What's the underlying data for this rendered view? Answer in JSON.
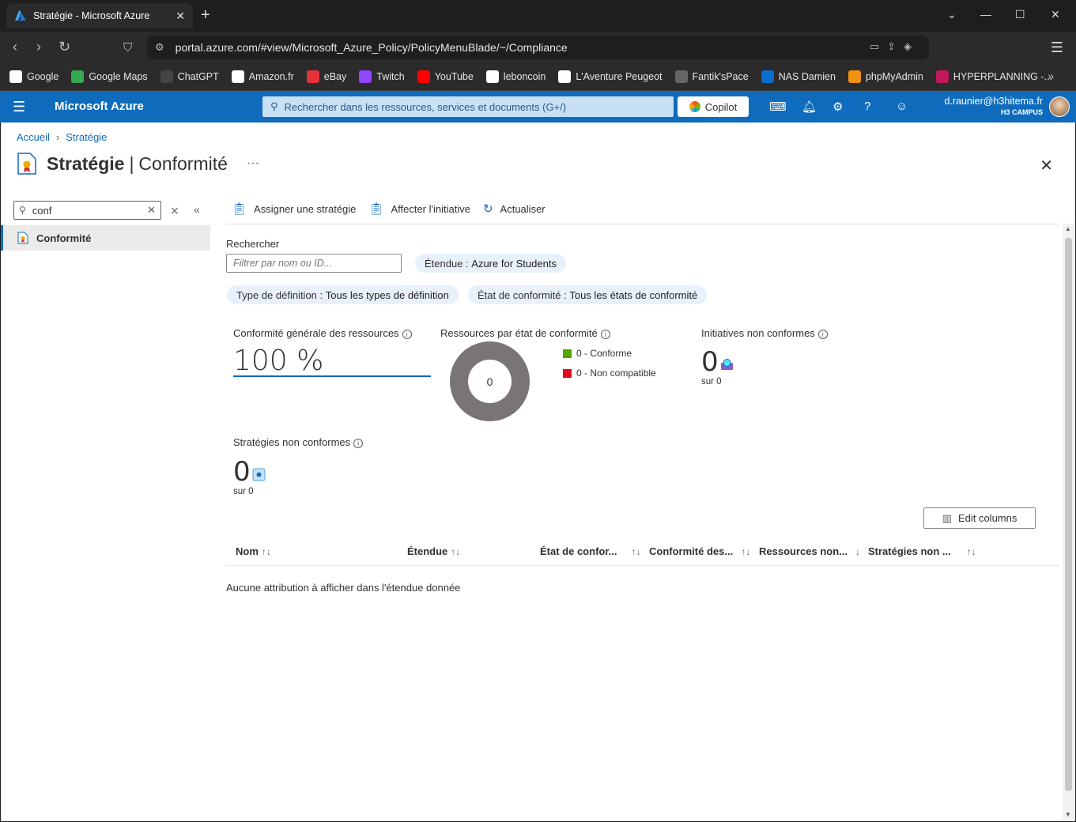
{
  "browser": {
    "tab_title": "Stratégie - Microsoft Azure",
    "tab_close": "✕",
    "new_tab": "+",
    "url": "portal.azure.com/#view/Microsoft_Azure_Policy/PolicyMenuBlade/~/Compliance",
    "bookmarks": [
      {
        "label": "Google",
        "icon": "google-icon",
        "color": "#ffffff"
      },
      {
        "label": "Google Maps",
        "icon": "maps-pin-icon",
        "color": "#34a853"
      },
      {
        "label": "ChatGPT",
        "icon": "chatgpt-icon",
        "color": "#444444"
      },
      {
        "label": "Amazon.fr",
        "icon": "amazon-icon",
        "color": "#ffffff"
      },
      {
        "label": "eBay",
        "icon": "ebay-icon",
        "color": "#e53238"
      },
      {
        "label": "Twitch",
        "icon": "twitch-icon",
        "color": "#9146ff"
      },
      {
        "label": "YouTube",
        "icon": "youtube-icon",
        "color": "#ff0000"
      },
      {
        "label": "leboncoin",
        "icon": "leboncoin-icon",
        "color": "#ffffff"
      },
      {
        "label": "L'Aventure Peugeot",
        "icon": "peugeot-icon",
        "color": "#ffffff"
      },
      {
        "label": "Fantik'sPace",
        "icon": "fantik-icon",
        "color": "#666666"
      },
      {
        "label": "NAS Damien",
        "icon": "dsm-icon",
        "color": "#0a6ed1"
      },
      {
        "label": "phpMyAdmin",
        "icon": "phpmyadmin-icon",
        "color": "#f29111"
      },
      {
        "label": "HYPERPLANNING -...",
        "icon": "hyperplanning-icon",
        "color": "#c2185b"
      }
    ]
  },
  "azure": {
    "brand": "Microsoft Azure",
    "search_placeholder": "Rechercher dans les ressources, services et documents (G+/)",
    "copilot": "Copilot",
    "user_email": "d.raunier@h3hitema.fr",
    "user_tenant": "H3 CAMPUS"
  },
  "breadcrumb": {
    "home": "Accueil",
    "current": "Stratégie"
  },
  "title": {
    "main": "Stratégie",
    "separator": "|",
    "sub": "Conformité",
    "more": "···"
  },
  "left_nav": {
    "search_value": "conf",
    "items": [
      {
        "label": "Conformité"
      }
    ]
  },
  "toolbar": {
    "assign_policy": "Assigner une stratégie",
    "assign_initiative": "Affecter l'initiative",
    "refresh": "Actualiser"
  },
  "filters": {
    "search_label": "Rechercher",
    "search_placeholder": "Filtrer par nom ou ID...",
    "scope_key": "Étendue : ",
    "scope_value": "Azure for Students",
    "type_key": "Type de définition : ",
    "type_value": "Tous les types de définition",
    "state_key": "État de conformité : ",
    "state_value": "Tous les états de conformité"
  },
  "cards": {
    "overall_title": "Conformité générale des ressources",
    "overall_value": "100 %",
    "by_state_title": "Ressources par état de conformité",
    "donut_center": "0",
    "legend_compliant": "0 - Conforme",
    "legend_noncompliant": "0 - Non compatible",
    "compliant_color": "#57a300",
    "noncompliant_color": "#e00b1c",
    "initiatives_title": "Initiatives non conformes",
    "initiatives_value": "0",
    "initiatives_total": "sur 0",
    "policies_title": "Stratégies non conformes",
    "policies_value": "0",
    "policies_total": "sur 0"
  },
  "table": {
    "edit_columns": "Edit columns",
    "columns": [
      {
        "label": "Nom",
        "sort": "↑↓"
      },
      {
        "label": "Étendue",
        "sort": "↑↓"
      },
      {
        "label": "État de confor...",
        "sort": "↑↓"
      },
      {
        "label": "Conformité des...",
        "sort": "↑↓"
      },
      {
        "label": "Ressources non...",
        "sort": "↓"
      },
      {
        "label": "Stratégies non ...",
        "sort": "↑↓"
      }
    ],
    "empty_message": "Aucune attribution à afficher dans l'étendue donnée"
  }
}
